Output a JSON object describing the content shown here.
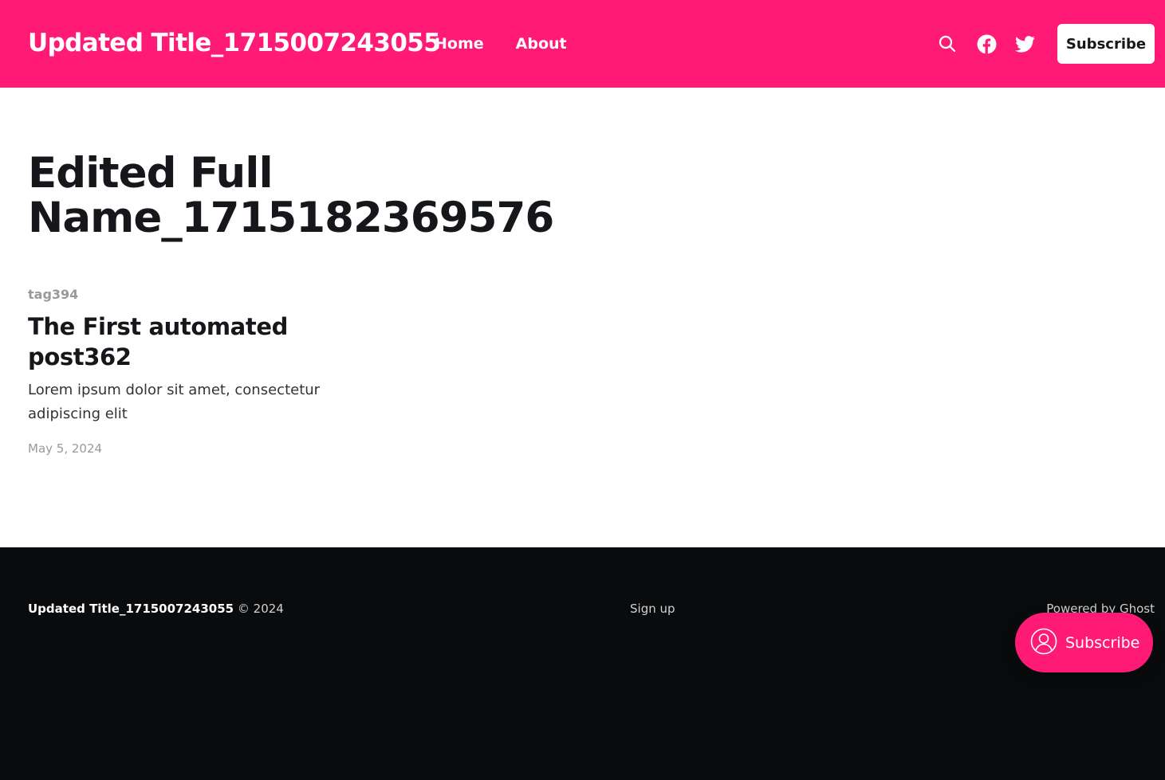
{
  "header": {
    "site_title": "Updated Title_1715007243055",
    "nav": [
      {
        "label": "Home"
      },
      {
        "label": "About"
      }
    ],
    "icons": [
      "search-icon",
      "facebook-icon",
      "twitter-icon"
    ],
    "subscribe_label": "Subscribe",
    "background_color": "#ff1a75"
  },
  "author": {
    "name": "Edited Full Name_1715182369576"
  },
  "posts": [
    {
      "tag": "tag394",
      "title": "The First automated post362",
      "excerpt": "Lorem ipsum dolor sit amet, consectetur adipiscing elit",
      "date": "May 5, 2024"
    }
  ],
  "footer": {
    "site_title": "Updated Title_1715007243055",
    "copyright": "© 2024",
    "signup_label": "Sign up",
    "powered_by": "Powered by Ghost",
    "background_color": "#0a0b0d"
  },
  "portal": {
    "label": "Subscribe",
    "icon": "user-circle-icon"
  }
}
